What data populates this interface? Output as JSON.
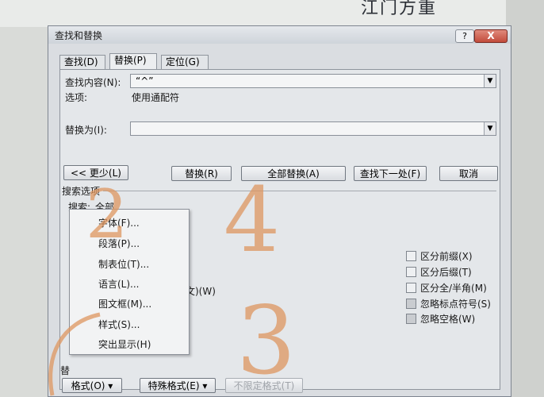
{
  "background": {
    "heading": "江门方重",
    "paper_color": "#e9ebe9"
  },
  "dialog": {
    "title": "查找和替换",
    "help_label": "?",
    "close_label": "X",
    "tabs": [
      {
        "label": "查找(D)"
      },
      {
        "label": "替换(P)",
        "active": true
      },
      {
        "label": "定位(G)"
      }
    ],
    "find": {
      "label": "查找内容(N):",
      "value": "“^”"
    },
    "options": {
      "label": "选项:",
      "value": "使用通配符"
    },
    "replace": {
      "label": "替换为(I):",
      "value": ""
    },
    "buttons": {
      "less": "<< 更少(L)",
      "replace": "替换(R)",
      "replace_all": "全部替换(A)",
      "find_next": "查找下一处(F)",
      "cancel": "取消"
    },
    "search_options": {
      "heading": "搜索选项",
      "search_label": "搜索:",
      "search_value": "全部"
    },
    "right_checkboxes": [
      {
        "label": "区分前缀(X)",
        "checked": false
      },
      {
        "label": "区分后缀(T)",
        "checked": false
      },
      {
        "label": "区分全/半角(M)",
        "checked": false
      },
      {
        "label": "忽略标点符号(S)",
        "checked": true
      },
      {
        "label": "忽略空格(W)",
        "checked": true
      }
    ],
    "partial_text": "文)(W)",
    "replace_section_label": "替",
    "bottom_buttons": {
      "format": "格式(O) ▾",
      "special": "特殊格式(E) ▾",
      "no_format": "不限定格式(T)"
    },
    "format_menu": [
      "字体(F)...",
      "段落(P)...",
      "制表位(T)...",
      "语言(L)...",
      "图文框(M)...",
      "样式(S)...",
      "突出显示(H)"
    ]
  },
  "annotations": {
    "two": "2",
    "three": "3",
    "four": "4",
    "color": "#de965f"
  }
}
